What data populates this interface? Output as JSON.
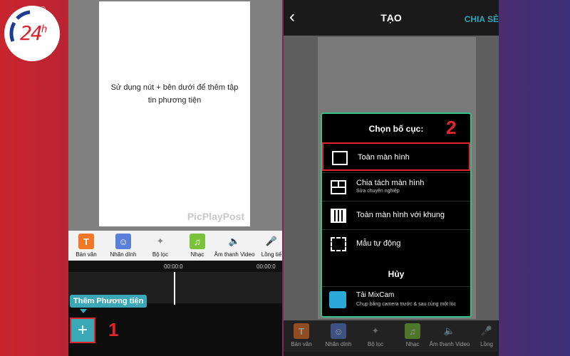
{
  "logo": {
    "text": "24",
    "superscript": "h",
    "registered": "®"
  },
  "left_screen": {
    "canvas_hint": "Sử dụng nút + bên dưới để thêm tập tin phương tiện",
    "watermark": "PicPlayPost",
    "toolbar": [
      {
        "label": "Bản văn",
        "icon": "text-icon",
        "glyph": "T",
        "color": "#f07828"
      },
      {
        "label": "Nhãn dính",
        "icon": "sticker-icon",
        "glyph": "☺",
        "color": "#5a7fd8"
      },
      {
        "label": "Bộ lọc",
        "icon": "magic-wand-icon",
        "glyph": "✦",
        "color": "#bbbbbb"
      },
      {
        "label": "Nhạc",
        "icon": "music-note-icon",
        "glyph": "♫",
        "color": "#7ac23a"
      },
      {
        "label": "Âm thanh Video",
        "icon": "speaker-icon",
        "glyph": "🔈",
        "color": "#bbbbbb"
      },
      {
        "label": "Lồng tiế",
        "icon": "microphone-icon",
        "glyph": "🎤",
        "color": "#bbbbbb"
      }
    ],
    "timecode_center": "00:00:0",
    "timecode_right": "00:00:0",
    "tooltip": "Thêm Phương tiện",
    "add_button": "+",
    "step_marker": "1"
  },
  "right_screen": {
    "back": "‹",
    "title": "TẠO",
    "share": "CHIA SẺ",
    "sheet_title": "Chọn bố cục:",
    "step_marker": "2",
    "options": [
      {
        "label": "Toàn màn hình",
        "sub": "",
        "icon": "fullscreen-icon"
      },
      {
        "label": "Chia tách màn hình",
        "sub": "Sửa chuyên nghiệp",
        "icon": "split-screen-icon"
      },
      {
        "label": "Toàn màn hình với khung",
        "sub": "",
        "icon": "fullscreen-frame-icon"
      },
      {
        "label": "Mẫu tự động",
        "sub": "",
        "icon": "auto-template-icon"
      }
    ],
    "cancel": "Hủy",
    "promo_title": "Tải MixCam",
    "promo_sub": "Chụp bằng camera trước & sau cùng một lúc",
    "toolbar": [
      {
        "label": "Bản văn",
        "glyph": "T",
        "color": "#f07828"
      },
      {
        "label": "Nhãn dính",
        "glyph": "☺",
        "color": "#5a7fd8"
      },
      {
        "label": "Bộ lọc",
        "glyph": "✦",
        "color": "#bbbbbb"
      },
      {
        "label": "Nhạc",
        "glyph": "♫",
        "color": "#7ac23a"
      },
      {
        "label": "Âm thanh Video",
        "glyph": "🔈",
        "color": "#bbbbbb"
      },
      {
        "label": "Lồng",
        "glyph": "🎤",
        "color": "#bbbbbb"
      }
    ]
  }
}
